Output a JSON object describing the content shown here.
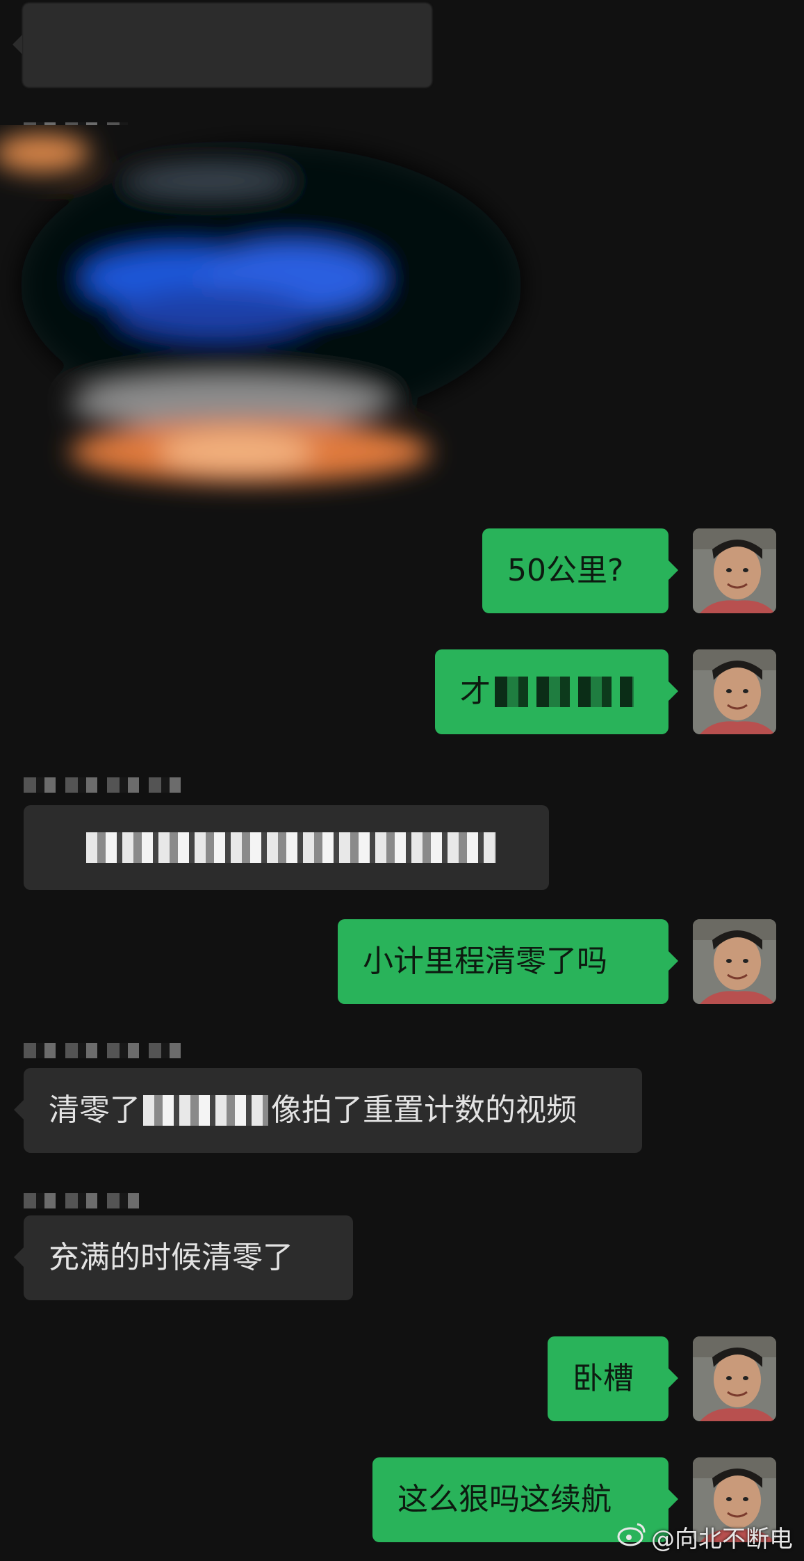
{
  "messages": {
    "m1": {
      "text": "50公里?"
    },
    "m2": {
      "text": "才"
    },
    "m3": {
      "text": "小计里程清零了吗"
    },
    "m4": {
      "prefix": "清零了",
      "suffix": "像拍了重置计数的视频"
    },
    "m5": {
      "text": "充满的时候清零了"
    },
    "m6": {
      "text": "卧槽"
    },
    "m7": {
      "text": "这么狠吗这续航"
    }
  },
  "watermark": {
    "text": "@向北不断电",
    "icon": "weibo-icon"
  },
  "colors": {
    "background": "#111111",
    "self_bubble": "#29b35a",
    "other_bubble": "#2c2c2c"
  }
}
